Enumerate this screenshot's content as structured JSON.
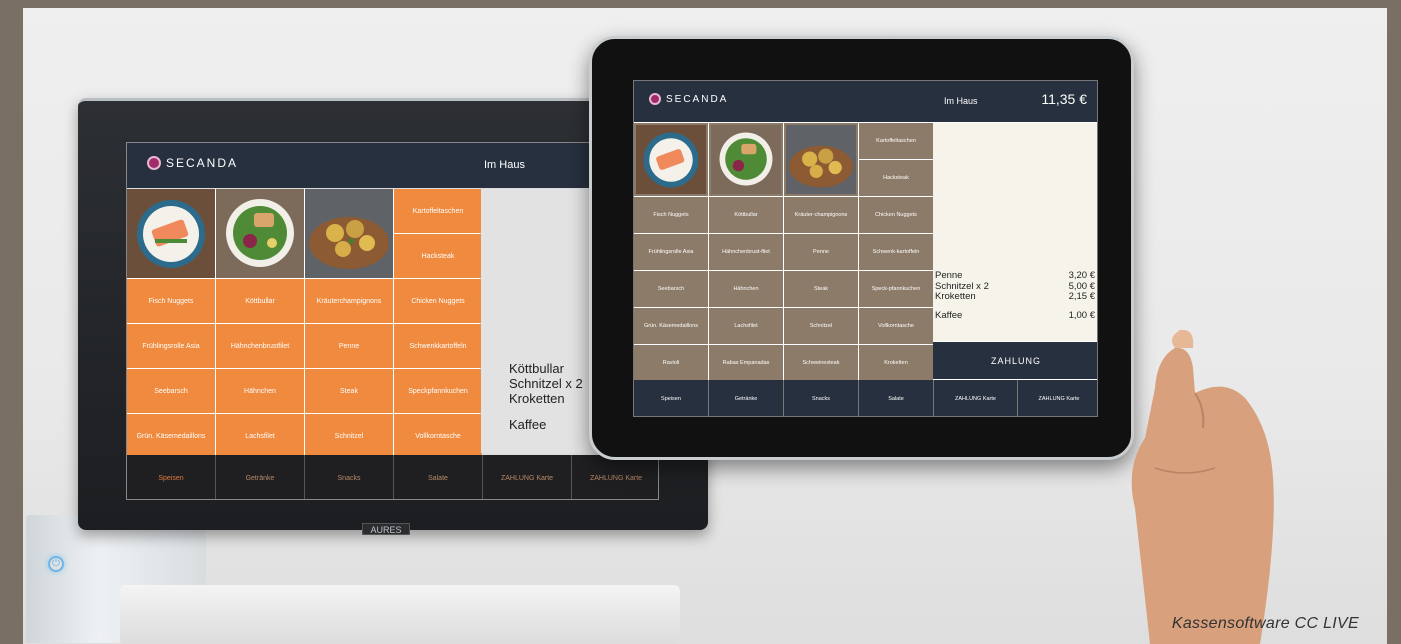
{
  "brand": "SECANDA",
  "caption": "Kassensoftware CC LIVE",
  "monitor": {
    "hardware_brand": "AURES",
    "header": {
      "mode": "Im Haus"
    },
    "grid_items": [
      "Kartoffeltaschen",
      "Hacksteak",
      "Fisch Nuggets",
      "Köttbullar",
      "Kräuterchampignons",
      "Chicken Nuggets",
      "Frühlingsrolle Asia",
      "Hähnchenbrustfilet",
      "Penne",
      "Schwenkkartoffeln",
      "Seebarsch",
      "Hähnchen",
      "Steak",
      "Speckpfannkuchen",
      "Grün. Käsemedaillons",
      "Lachsfilet",
      "Schnitzel",
      "Vollkorntasche"
    ],
    "order": [
      "Köttbullar",
      "Schnitzel x 2",
      "Kroketten",
      "Kaffee"
    ],
    "bottom": [
      "Speisen",
      "Getränke",
      "Snacks",
      "Salate",
      "ZAHLUNG Karte",
      "ZAHLUNG Karte"
    ]
  },
  "tablet": {
    "header": {
      "mode": "Im Haus",
      "total": "11,35 €"
    },
    "grid_items": [
      "Kartoffeltaschen",
      "Hacksteak",
      "Fisch Nuggets",
      "Köttbullar",
      "Kräuter-champignons",
      "Chicken Nuggets",
      "Frühlingsrolle Asia",
      "Hähnchenbrust-filet",
      "Penne",
      "Schwenk-kartoffeln",
      "Seebarsch",
      "Hähnchen",
      "Steak",
      "Speck-pfannkuchen",
      "Grün. Käsemedaillons",
      "Lachsfilet",
      "Schnitzel",
      "Vollkorntasche",
      "Ravioli",
      "Rabas Empanadas",
      "Schweinesteak",
      "Kroketten"
    ],
    "order": [
      {
        "item": "Penne",
        "price": "3,20 €"
      },
      {
        "item": "Schnitzel x 2",
        "price": "5,00 €"
      },
      {
        "item": "Kroketten",
        "price": "2,15 €"
      },
      {
        "item": "Kaffee",
        "price": "1,00 €"
      }
    ],
    "pay": "ZAHLUNG",
    "bottom": [
      "Speisen",
      "Getränke",
      "Snacks",
      "Salate",
      "ZAHLUNG Karte",
      "ZAHLUNG Karte"
    ]
  }
}
